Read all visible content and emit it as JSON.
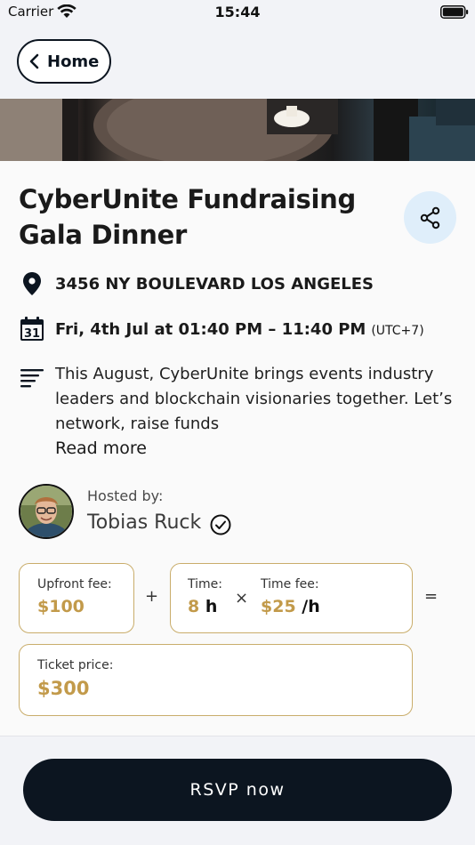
{
  "status_bar": {
    "carrier": "Carrier",
    "time": "15:44"
  },
  "header": {
    "back_label": "Home"
  },
  "event": {
    "title": "CyberUnite Fundraising Gala Dinner",
    "address": "3456 NY BOULEVARD LOS ANGELES",
    "datetime": "Fri, 4th Jul at 01:40 PM – 11:40 PM",
    "timezone": "(UTC+7)",
    "description": "This August, CyberUnite brings events industry leaders and blockchain visionaries together. Let’s network, raise funds",
    "read_more": "Read more"
  },
  "host": {
    "label": "Hosted by:",
    "name": "Tobias Ruck"
  },
  "pricing": {
    "upfront_label": "Upfront fee:",
    "upfront_value": "$100",
    "plus": "+",
    "time_label": "Time:",
    "time_value": "8",
    "time_unit": "h",
    "times": "×",
    "time_fee_label": "Time fee:",
    "time_fee_value": "$25",
    "time_fee_unit": "/h",
    "equals": "=",
    "ticket_label": "Ticket price:",
    "ticket_value": "$300"
  },
  "actions": {
    "rsvp_label": "RSVP now"
  },
  "colors": {
    "accent": "#c29a4a",
    "primary": "#0c1520",
    "share_bg": "#dfeefa"
  }
}
